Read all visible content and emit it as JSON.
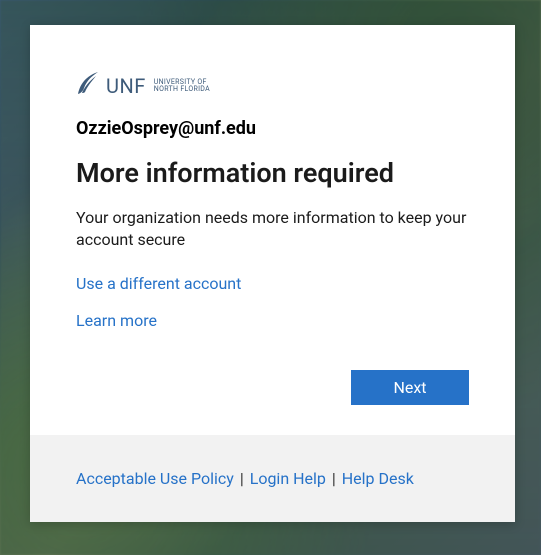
{
  "logo": {
    "mark_name": "osprey-icon",
    "text_main": "UNF",
    "text_sub_line1": "University of",
    "text_sub_line2": "North Florida"
  },
  "account": {
    "email": "OzzieOsprey@unf.edu"
  },
  "prompt": {
    "title": "More information required",
    "body": "Your organization needs more information to keep your account secure",
    "different_account": "Use a different account",
    "learn_more": "Learn more",
    "next_button": "Next"
  },
  "footer": {
    "acceptable_use": "Acceptable Use Policy",
    "login_help": "Login Help",
    "help_desk": "Help Desk",
    "separator": "|"
  },
  "colors": {
    "link": "#2672c8",
    "primary_button": "#2672c8",
    "logo": "#3e5b7a"
  }
}
